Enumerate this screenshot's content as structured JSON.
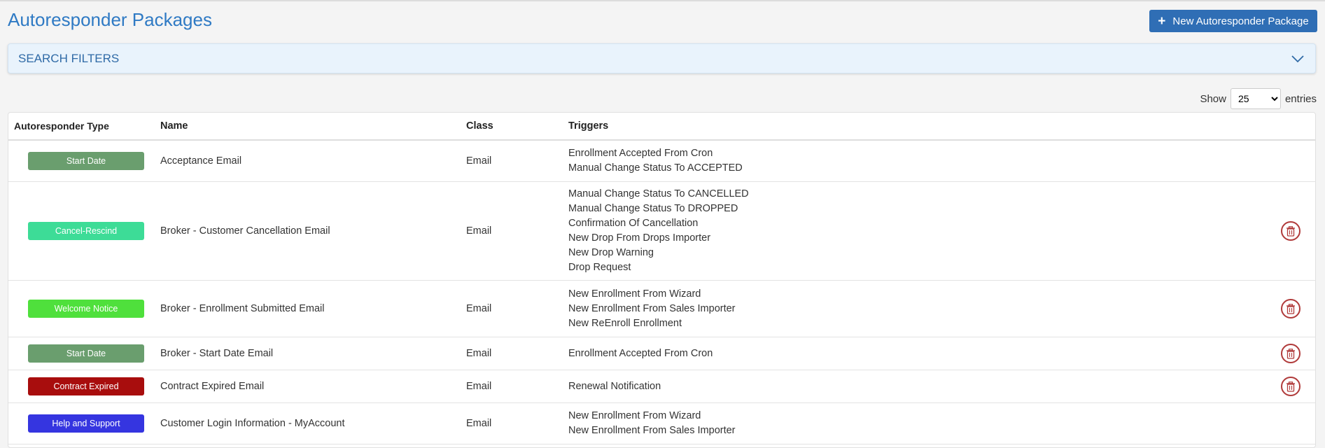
{
  "header": {
    "title": "Autoresponder Packages",
    "new_button_label": "New Autoresponder Package"
  },
  "filters": {
    "label": "SEARCH FILTERS"
  },
  "entries": {
    "show_label": "Show",
    "value": "25",
    "entries_label": "entries"
  },
  "table": {
    "columns": [
      "Autoresponder Type",
      "Name",
      "Class",
      "Triggers"
    ],
    "rows": [
      {
        "type": "Start Date",
        "type_color": "#6a9e6e",
        "name": "Acceptance Email",
        "class": "Email",
        "triggers": [
          "Enrollment Accepted From Cron",
          "Manual Change Status To ACCEPTED"
        ],
        "deletable": false
      },
      {
        "type": "Cancel-Rescind",
        "type_color": "#3ddc97",
        "name": "Broker - Customer Cancellation Email",
        "class": "Email",
        "triggers": [
          "Manual Change Status To CANCELLED",
          "Manual Change Status To DROPPED",
          "Confirmation Of Cancellation",
          "New Drop From Drops Importer",
          "New Drop Warning",
          "Drop Request"
        ],
        "deletable": true
      },
      {
        "type": "Welcome Notice",
        "type_color": "#4fe03c",
        "name": "Broker - Enrollment Submitted Email",
        "class": "Email",
        "triggers": [
          "New Enrollment From Wizard",
          "New Enrollment From Sales Importer",
          "New ReEnroll Enrollment"
        ],
        "deletable": true
      },
      {
        "type": "Start Date",
        "type_color": "#6a9e6e",
        "name": "Broker - Start Date Email",
        "class": "Email",
        "triggers": [
          "Enrollment Accepted From Cron"
        ],
        "deletable": true
      },
      {
        "type": "Contract Expired",
        "type_color": "#a80d0d",
        "name": "Contract Expired Email",
        "class": "Email",
        "triggers": [
          "Renewal Notification"
        ],
        "deletable": true
      },
      {
        "type": "Help and Support",
        "type_color": "#3535e0",
        "name": "Customer Login Information - MyAccount",
        "class": "Email",
        "triggers": [
          "New Enrollment From Wizard",
          "New Enrollment From Sales Importer"
        ],
        "deletable": false
      }
    ]
  },
  "icons": {
    "plus": "plus-icon",
    "chevron": "chevron-down-icon",
    "trash": "trash-icon"
  },
  "colors": {
    "accent": "#2f6eb5",
    "title": "#2f7ac4",
    "danger": "#b03a3a"
  }
}
